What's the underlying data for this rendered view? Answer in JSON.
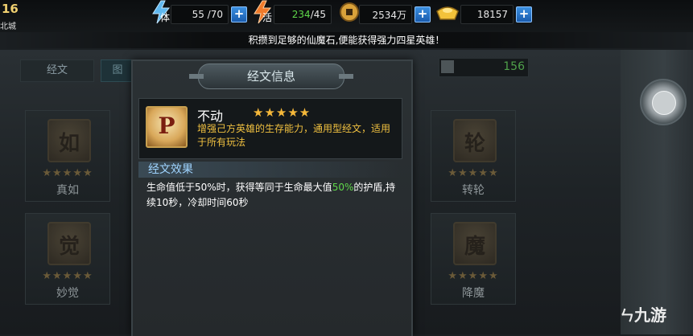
{
  "top": {
    "level": "16",
    "city": "北城",
    "stamina": {
      "icon_text": "体",
      "value": "55 /70"
    },
    "vigor": {
      "icon_text": "活",
      "current": "234",
      "max": " /45"
    },
    "coins": {
      "value": "2534万"
    },
    "gold": {
      "value": "18157"
    },
    "plus_label": "+"
  },
  "notice": "积攒到足够的仙魔石,便能获得强力四星英雄！",
  "tabs": [
    "经文",
    "图"
  ],
  "counter": "156",
  "cards": [
    {
      "name": "真如",
      "glyph": "如",
      "stars": "★★★★★"
    },
    {
      "name": "妙觉",
      "glyph": "觉",
      "stars": "★★★★★"
    },
    {
      "name": "转轮",
      "glyph": "轮",
      "stars": "★★★★★"
    },
    {
      "name": "降魔",
      "glyph": "魔",
      "stars": "★★★★★"
    }
  ],
  "modal": {
    "title": "经文信息",
    "item": {
      "glyph": "P",
      "name": "不动",
      "stars": "★★★★★",
      "description": "增强己方英雄的生存能力，通用型经文，适用于所有玩法"
    },
    "effect": {
      "title": "经文效果",
      "line_part1": "生命值低于50%时，获得等同于生命最大值",
      "highlight": "50%",
      "line_part2": "的护盾,持续10秒，冷却时间60秒"
    }
  },
  "watermark": "九游",
  "colors": {
    "star_gold": "#f5b83a",
    "desc_yellow": "#f0c040",
    "highlight_green": "#5fd84a",
    "accent_blue": "#3b8fe0"
  }
}
